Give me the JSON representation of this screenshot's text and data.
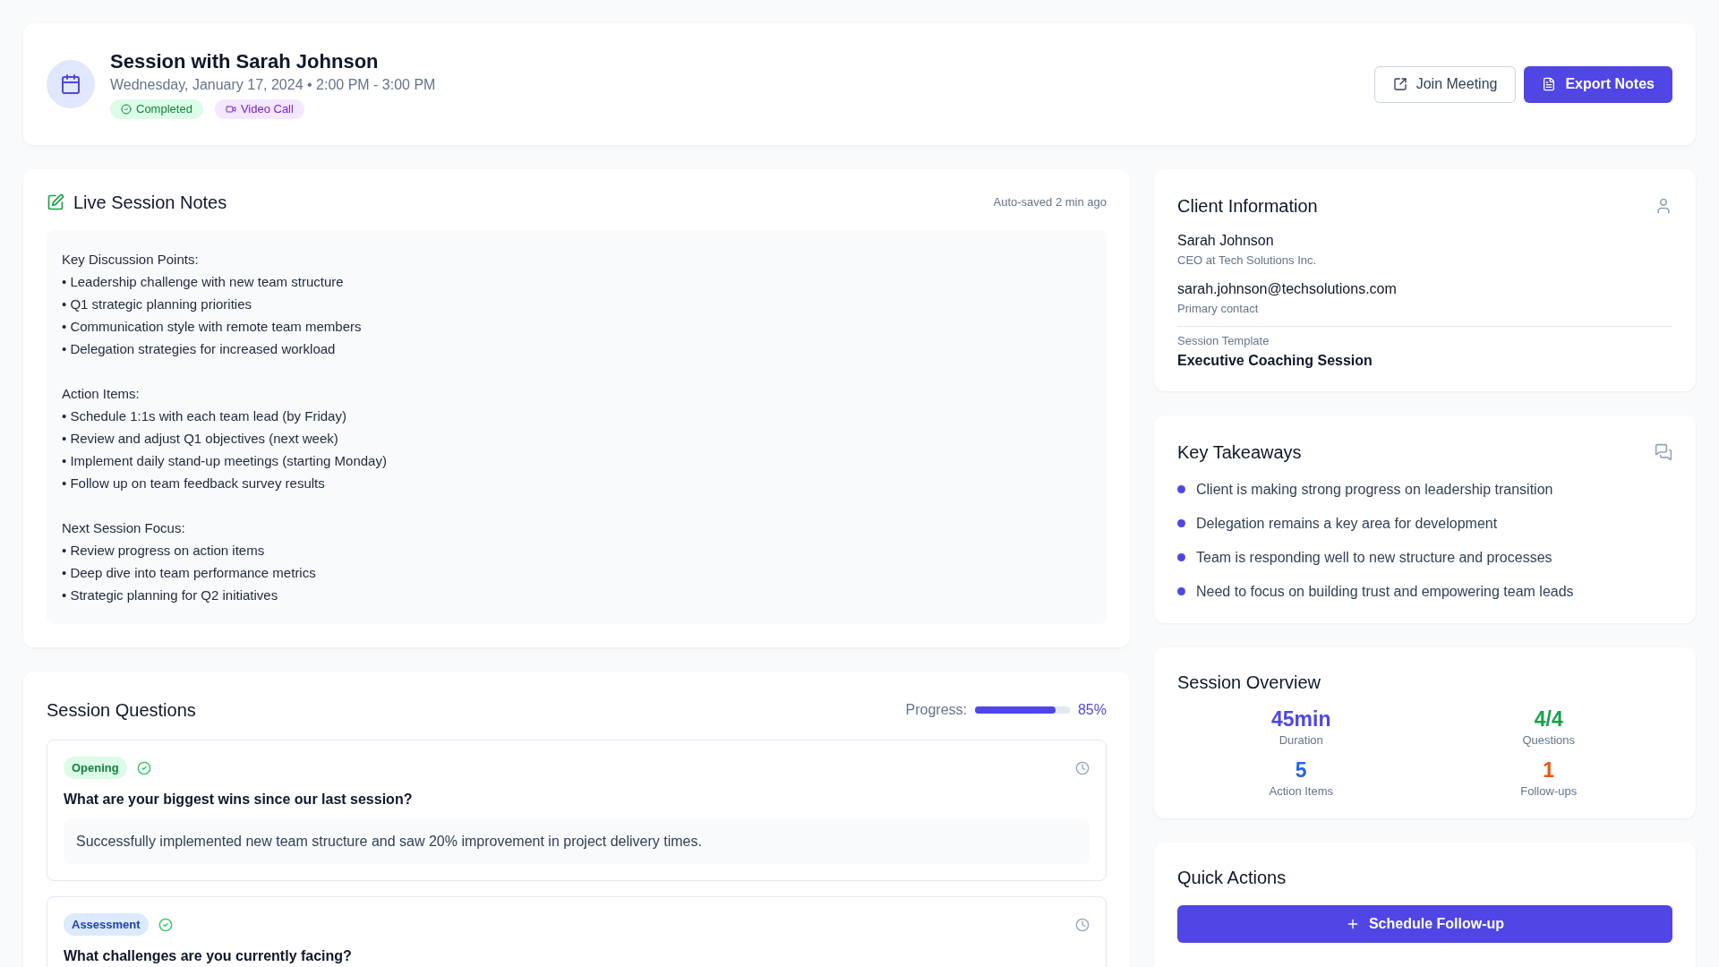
{
  "header": {
    "title": "Session with Sarah Johnson",
    "datetime": "Wednesday, January 17, 2024 • 2:00 PM - 3:00 PM",
    "badges": [
      {
        "kind": "status",
        "label": "Completed",
        "color": "#dcfce7"
      },
      {
        "kind": "video",
        "label": "Video Call",
        "color": "#f3e8ff"
      }
    ],
    "buttons": [
      {
        "kind": "secondary",
        "label": "Join Meeting"
      },
      {
        "kind": "primary",
        "label": "Export Notes"
      }
    ]
  },
  "notes": {
    "title": "Live Session Notes",
    "autosave": "Auto-saved 2 min ago",
    "text": "Key Discussion Points:\n• Leadership challenge with new team structure\n• Q1 strategic planning priorities\n• Communication style with remote team members\n• Delegation strategies for increased workload\n\nAction Items:\n• Schedule 1:1s with each team lead (by Friday)\n• Review and adjust Q1 objectives (next week)\n• Implement daily stand-up meetings (starting Monday)\n• Follow up on team feedback survey results\n\nNext Session Focus:\n• Review progress on action items\n• Deep dive into team performance metrics\n• Strategic planning for Q2 initiatives"
  },
  "questions": {
    "title": "Session Questions",
    "progress_label": "Progress:",
    "level": 0.85,
    "progress_text": "85%",
    "items": [
      {
        "category": "Opening",
        "color": "#dcfce7",
        "answered": true,
        "question": "What are your biggest wins since our last session?",
        "answer": "Successfully implemented new team structure and saw 20% improvement in project delivery times."
      },
      {
        "category": "Assessment",
        "color": "#dbeafe",
        "answered": true,
        "question": "What challenges are you currently facing?"
      }
    ]
  },
  "client": {
    "title": "Client Information",
    "name": "Sarah Johnson",
    "role": "CEO at Tech Solutions Inc.",
    "email": "sarah.johnson@techsolutions.com",
    "email_note": "Primary contact",
    "template_label": "Session Template",
    "template": "Executive Coaching Session"
  },
  "takeaways": {
    "title": "Key Takeaways",
    "items": [
      "Client is making strong progress on leadership transition",
      "Delegation remains a key area for development",
      "Team is responding well to new structure and processes",
      "Need to focus on building trust and empowering team leads"
    ]
  },
  "overview": {
    "title": "Session Overview",
    "stats": [
      {
        "value": "45min",
        "label": "Duration",
        "color": "#4f46e5"
      },
      {
        "value": "4/4",
        "label": "Questions",
        "color": "#16a34a"
      },
      {
        "value": "5",
        "label": "Action Items",
        "color": "#2563eb"
      },
      {
        "value": "1",
        "label": "Follow-ups",
        "color": "#ea580c"
      }
    ]
  },
  "quick_actions": {
    "title": "Quick Actions",
    "buttons": [
      "Schedule Follow-up"
    ]
  }
}
